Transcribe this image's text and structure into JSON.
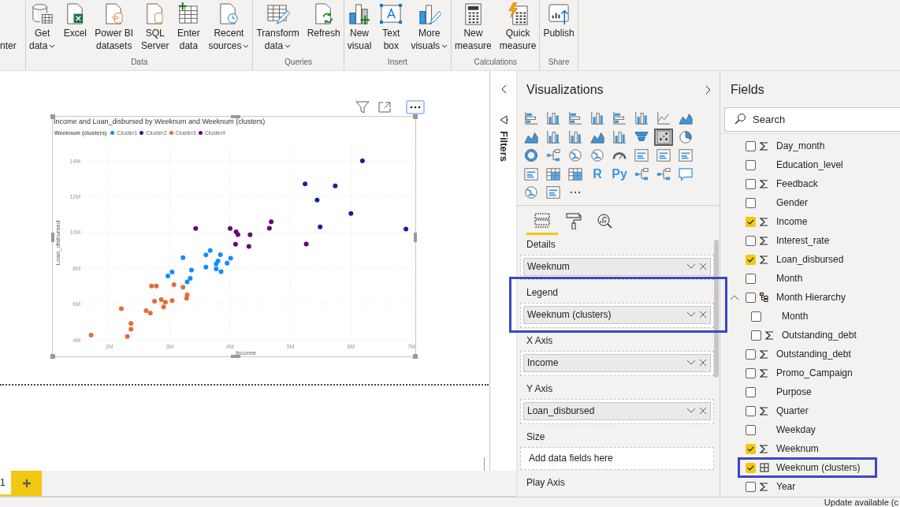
{
  "ribbon": {
    "partial_label": "nter",
    "groups": [
      {
        "label": "Data",
        "buttons": [
          {
            "lines": [
              "Get",
              "data"
            ],
            "dropdown": true
          },
          {
            "lines": [
              "Excel"
            ],
            "dropdown": false
          },
          {
            "lines": [
              "Power BI",
              "datasets"
            ],
            "dropdown": false
          },
          {
            "lines": [
              "SQL",
              "Server"
            ],
            "dropdown": false
          },
          {
            "lines": [
              "Enter",
              "data"
            ],
            "dropdown": false
          },
          {
            "lines": [
              "Recent",
              "sources"
            ],
            "dropdown": true
          }
        ]
      },
      {
        "label": "Queries",
        "buttons": [
          {
            "lines": [
              "Transform",
              "data"
            ],
            "dropdown": true
          },
          {
            "lines": [
              "Refresh"
            ],
            "dropdown": false
          }
        ]
      },
      {
        "label": "Insert",
        "buttons": [
          {
            "lines": [
              "New",
              "visual"
            ],
            "dropdown": false
          },
          {
            "lines": [
              "Text",
              "box"
            ],
            "dropdown": false
          },
          {
            "lines": [
              "More",
              "visuals"
            ],
            "dropdown": true
          }
        ]
      },
      {
        "label": "Calculations",
        "buttons": [
          {
            "lines": [
              "New",
              "measure"
            ],
            "dropdown": false
          },
          {
            "lines": [
              "Quick",
              "measure"
            ],
            "dropdown": false
          }
        ]
      },
      {
        "label": "Share",
        "buttons": [
          {
            "lines": [
              "Publish"
            ],
            "dropdown": false
          }
        ]
      }
    ]
  },
  "canvas": {
    "visual": {
      "selected": true,
      "legend_title": "Weeknum (clusters)",
      "chart_data": {
        "type": "scatter",
        "legend": true,
        "title": "Income and Loan_disbursed by Weeknum and Weeknum (clusters)",
        "xlabel": "Income",
        "ylabel": "Loan_disbursed",
        "grid": true,
        "xlim": [
          1.5,
          7
        ],
        "ylim": [
          4,
          15
        ],
        "xticks": [
          {
            "value": 2,
            "label": "2M"
          },
          {
            "value": 3,
            "label": "3M"
          },
          {
            "value": 4,
            "label": "4M"
          },
          {
            "value": 5,
            "label": "5M"
          },
          {
            "value": 6,
            "label": "6M"
          },
          {
            "value": 7,
            "label": "7M"
          }
        ],
        "yticks": [
          {
            "value": 4,
            "label": "4M"
          },
          {
            "value": 6,
            "label": "6M"
          },
          {
            "value": 8,
            "label": "8M"
          },
          {
            "value": 10,
            "label": "10M"
          },
          {
            "value": 12,
            "label": "12M"
          },
          {
            "value": 14,
            "label": "14M"
          }
        ],
        "series": [
          {
            "name": "Cluster1",
            "color": "#118dff",
            "x": [
              3.22,
              3.6,
              3.67,
              3.84,
              4.01,
              3.6,
              3.77,
              3.8,
              3.77,
              3.85,
              3.95,
              3.36,
              3.04,
              2.97,
              3.34,
              3.29
            ],
            "values": [
              8.59,
              8.75,
              8.99,
              8.76,
              8.56,
              8.06,
              8.24,
              8.41,
              7.97,
              7.81,
              8.28,
              7.9,
              7.79,
              7.57,
              7.43,
              7.24
            ]
          },
          {
            "name": "Cluster2",
            "color": "#12239e",
            "x": [
              6.19,
              5.24,
              5.74,
              5.44,
              6.0,
              5.49,
              6.91
            ],
            "values": [
              14.0,
              12.71,
              12.6,
              11.81,
              11.06,
              10.31,
              10.19
            ]
          },
          {
            "name": "Cluster3",
            "color": "#e66c37",
            "x": [
              1.7,
              2.2,
              2.3,
              2.36,
              2.36,
              2.61,
              2.68,
              2.7,
              2.78,
              2.75,
              2.86,
              2.9,
              2.93,
              3.04,
              3.07,
              3.22,
              3.28,
              3.29
            ],
            "values": [
              4.26,
              5.74,
              4.19,
              4.91,
              4.59,
              5.63,
              5.5,
              7.01,
              7.01,
              6.16,
              6.25,
              5.84,
              6.1,
              6.19,
              7.09,
              6.94,
              6.32,
              6.51
            ]
          },
          {
            "name": "Cluster4",
            "color": "#6b007b",
            "x": [
              3.43,
              4.0,
              4.1,
              4.13,
              4.33,
              4.09,
              4.31,
              4.65,
              4.68,
              5.26
            ],
            "values": [
              10.22,
              10.22,
              10.03,
              9.88,
              9.87,
              9.34,
              9.22,
              10.24,
              10.6,
              9.35
            ]
          }
        ]
      }
    }
  },
  "filters_pane": {
    "title": "Filters"
  },
  "visualizations": {
    "title": "Visualizations",
    "gallery": [
      {
        "selected": false
      },
      {
        "selected": false
      },
      {
        "selected": false
      },
      {
        "selected": false
      },
      {
        "selected": false
      },
      {
        "selected": false
      },
      {
        "selected": false
      },
      {
        "selected": false
      },
      {
        "selected": false
      },
      {
        "selected": false
      },
      {
        "selected": false
      },
      {
        "selected": false
      },
      {
        "selected": false
      },
      {
        "selected": false
      },
      {
        "selected": true
      },
      {
        "selected": false
      },
      {
        "selected": false
      },
      {
        "selected": false
      },
      {
        "selected": false
      },
      {
        "selected": false
      },
      {
        "selected": false
      },
      {
        "selected": false
      },
      {
        "selected": false
      },
      {
        "selected": false
      },
      {
        "selected": false
      },
      {
        "selected": false
      },
      {
        "selected": false
      },
      {
        "selected": false,
        "glyph": "R"
      },
      {
        "selected": false,
        "glyph": "Py"
      },
      {
        "selected": false
      },
      {
        "selected": false
      },
      {
        "selected": false
      },
      {
        "selected": false
      },
      {
        "selected": false
      }
    ],
    "pane_tabs": [
      {
        "selected": true
      },
      {
        "selected": false
      },
      {
        "selected": false
      }
    ],
    "wells": [
      {
        "label": "Details",
        "field": "Weeknum",
        "highlighted": false
      },
      {
        "label": "Legend",
        "field": "Weeknum (clusters)",
        "highlighted": true
      },
      {
        "label": "X Axis",
        "field": "Income",
        "highlighted": false
      },
      {
        "label": "Y Axis",
        "field": "Loan_disbursed",
        "highlighted": false
      },
      {
        "label": "Size",
        "placeholder": "Add data fields here",
        "highlighted": false
      },
      {
        "label": "Play Axis",
        "highlighted": false
      }
    ]
  },
  "fields": {
    "title": "Fields",
    "search": {
      "placeholder": "Search"
    },
    "items": [
      {
        "name": "Day_month",
        "kind": "sum",
        "checked": false,
        "highlighted": false
      },
      {
        "name": "Education_level",
        "kind": "plain",
        "checked": false,
        "highlighted": false
      },
      {
        "name": "Feedback",
        "kind": "sum",
        "checked": false,
        "highlighted": false
      },
      {
        "name": "Gender",
        "kind": "plain",
        "checked": false,
        "highlighted": false
      },
      {
        "name": "Income",
        "kind": "sum",
        "checked": true,
        "highlighted": false
      },
      {
        "name": "Interest_rate",
        "kind": "sum",
        "checked": false,
        "highlighted": false
      },
      {
        "name": "Loan_disbursed",
        "kind": "sum",
        "checked": true,
        "highlighted": false
      },
      {
        "name": "Month",
        "kind": "plain",
        "checked": false,
        "highlighted": false
      },
      {
        "name": "Month Hierarchy",
        "kind": "hierarchy",
        "checked": false,
        "highlighted": false,
        "expanded": true,
        "children": [
          {
            "name": "Month",
            "kind": "plain",
            "checked": false,
            "highlighted": false
          },
          {
            "name": "Outstanding_debt",
            "kind": "sum",
            "checked": false,
            "highlighted": false
          }
        ]
      },
      {
        "name": "Outstanding_debt",
        "kind": "sum",
        "checked": false,
        "highlighted": false
      },
      {
        "name": "Promo_Campaign",
        "kind": "sum",
        "checked": false,
        "highlighted": false
      },
      {
        "name": "Purpose",
        "kind": "plain",
        "checked": false,
        "highlighted": false
      },
      {
        "name": "Quarter",
        "kind": "sum",
        "checked": false,
        "highlighted": false
      },
      {
        "name": "Weekday",
        "kind": "plain",
        "checked": false,
        "highlighted": false
      },
      {
        "name": "Weeknum",
        "kind": "sum",
        "checked": true,
        "highlighted": false
      },
      {
        "name": "Weeknum (clusters)",
        "kind": "group",
        "checked": true,
        "highlighted": true
      },
      {
        "name": "Year",
        "kind": "sum",
        "checked": false,
        "highlighted": false
      }
    ]
  },
  "page_tabs": [
    {
      "label": "1",
      "selected": true
    }
  ],
  "status_bar": {
    "text": "Update available (c"
  }
}
